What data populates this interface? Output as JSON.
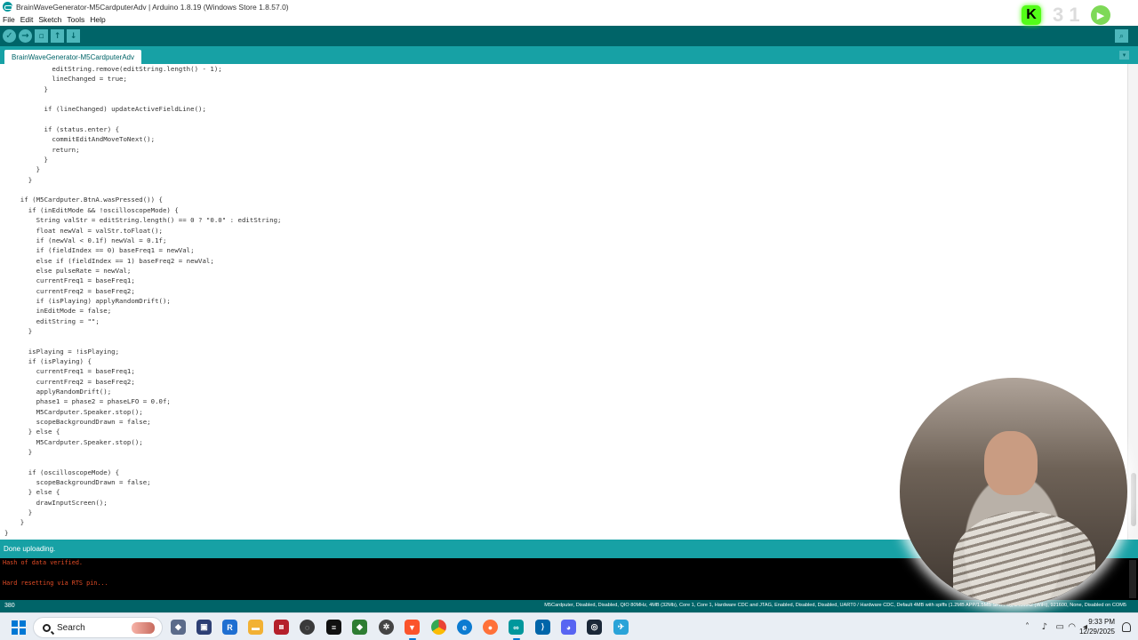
{
  "window": {
    "title": "BrainWaveGenerator-M5CardputerAdv | Arduino 1.8.19 (Windows Store 1.8.57.0)"
  },
  "menu": [
    "File",
    "Edit",
    "Sketch",
    "Tools",
    "Help"
  ],
  "toolbar": {
    "verify": "✓",
    "upload": "→",
    "new": "▫",
    "open": "↑",
    "save": "↓",
    "serial_monitor": "⌕"
  },
  "overlay": {
    "kick_logo": "K",
    "number": "3 1"
  },
  "tab": {
    "name": "BrainWaveGenerator-M5CardputerAdv"
  },
  "code": [
    "            editString.remove(editString.length() - 1);",
    "            lineChanged = true;",
    "          }",
    "",
    "          if (lineChanged) updateActiveFieldLine();",
    "",
    "          if (status.enter) {",
    "            commitEditAndMoveToNext();",
    "            return;",
    "          }",
    "        }",
    "      }",
    "",
    "    if (M5Cardputer.BtnA.wasPressed()) {",
    "      if (inEditMode && !oscilloscopeMode) {",
    "        String valStr = editString.length() == 0 ? \"0.0\" : editString;",
    "        float newVal = valStr.toFloat();",
    "        if (newVal < 0.1f) newVal = 0.1f;",
    "        if (fieldIndex == 0) baseFreq1 = newVal;",
    "        else if (fieldIndex == 1) baseFreq2 = newVal;",
    "        else pulseRate = newVal;",
    "        currentFreq1 = baseFreq1;",
    "        currentFreq2 = baseFreq2;",
    "        if (isPlaying) applyRandomDrift();",
    "        inEditMode = false;",
    "        editString = \"\";",
    "      }",
    "",
    "      isPlaying = !isPlaying;",
    "      if (isPlaying) {",
    "        currentFreq1 = baseFreq1;",
    "        currentFreq2 = baseFreq2;",
    "        applyRandomDrift();",
    "        phase1 = phase2 = phaseLFO = 0.0f;",
    "        M5Cardputer.Speaker.stop();",
    "        scopeBackgroundDrawn = false;",
    "      } else {",
    "        M5Cardputer.Speaker.stop();",
    "      }",
    "",
    "      if (oscilloscopeMode) {",
    "        scopeBackgroundDrawn = false;",
    "      } else {",
    "        drawInputScreen();",
    "      }",
    "    }",
    "}"
  ],
  "status": {
    "message": "Done uploading."
  },
  "console": [
    "Hash of data verified.",
    "",
    "Hard resetting via RTS pin..."
  ],
  "footer": {
    "line_number": "380",
    "board_info": "M5Cardputer, Disabled, Disabled, QIO 80MHz, 4MB (32Mb), Core 1, Core 1, Hardware CDC and JTAG, Enabled, Disabled, Disabled, UART0 / Hardware CDC, Default 4MB with spiffs (1.2MB APP/1.5MB SPIFFS), 240MHz (WiFi), 921600, None, Disabled on COM5"
  },
  "taskbar": {
    "search_label": "Search",
    "time": "9:33 PM",
    "date": "12/29/2025"
  },
  "colors": {
    "toolbar": "#006468",
    "tabbar": "#17a1a5",
    "console_text": "#e34c26"
  }
}
